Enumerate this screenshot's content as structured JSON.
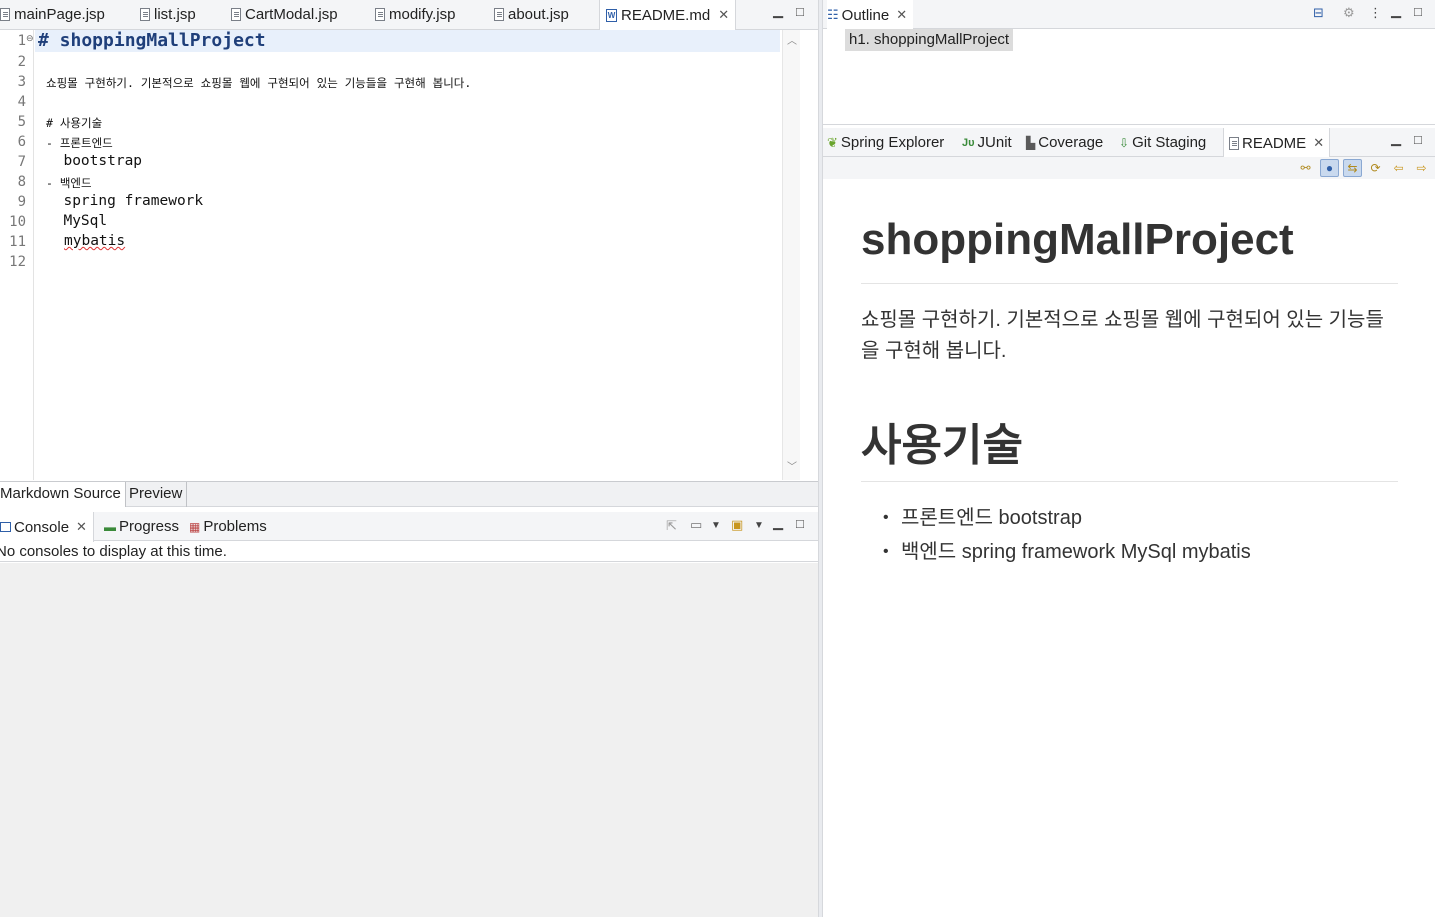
{
  "editor": {
    "tabs": [
      {
        "label": "mainPage.jsp",
        "icon": "file-icon"
      },
      {
        "label": "list.jsp",
        "icon": "file-icon"
      },
      {
        "label": "CartModal.jsp",
        "icon": "file-icon"
      },
      {
        "label": "modify.jsp",
        "icon": "file-icon"
      },
      {
        "label": "about.jsp",
        "icon": "file-icon"
      },
      {
        "label": "README.md",
        "icon": "markdown-file-icon",
        "active": true
      }
    ],
    "line_numbers": [
      "1",
      "2",
      "3",
      "4",
      "5",
      "6",
      "7",
      "8",
      "9",
      "10",
      "11",
      "12"
    ],
    "lines": {
      "l1": "# shoppingMallProject",
      "l3": "쇼핑몰 구현하기. 기본적으로 쇼핑몰 웹에 구현되어 있는 기능들을 구현해 봅니다.",
      "l5": "# 사용기술",
      "l6": "- 프론트엔드",
      "l7": "  bootstrap",
      "l8": "- 백엔드",
      "l9": "  spring framework",
      "l10": "  MySql",
      "l11": "mybatis"
    },
    "mode_tabs": {
      "source": "Markdown Source",
      "preview": "Preview"
    }
  },
  "console": {
    "tabs": {
      "console": "Console",
      "progress": "Progress",
      "problems": "Problems"
    },
    "message": "No consoles to display at this time."
  },
  "outline": {
    "tab": "Outline",
    "item": "h1. shoppingMallProject"
  },
  "preview_panel": {
    "tabs": {
      "spring": "Spring Explorer",
      "junit": "JUnit",
      "coverage": "Coverage",
      "git": "Git Staging",
      "readme": "README"
    },
    "rendered": {
      "h1": "shoppingMallProject",
      "paragraph": "쇼핑몰 구현하기. 기본적으로 쇼핑몰 웹에 구현되어 있는 기능들을 구현해 봅니다.",
      "h2": "사용기술",
      "list": [
        "프론트엔드 bootstrap",
        "백엔드 spring framework MySql mybatis"
      ]
    }
  },
  "colors": {
    "accent": "#1f3f7a",
    "highlight_line": "#e8f0fb",
    "toolbar_pressed": "#c9d9ee"
  }
}
